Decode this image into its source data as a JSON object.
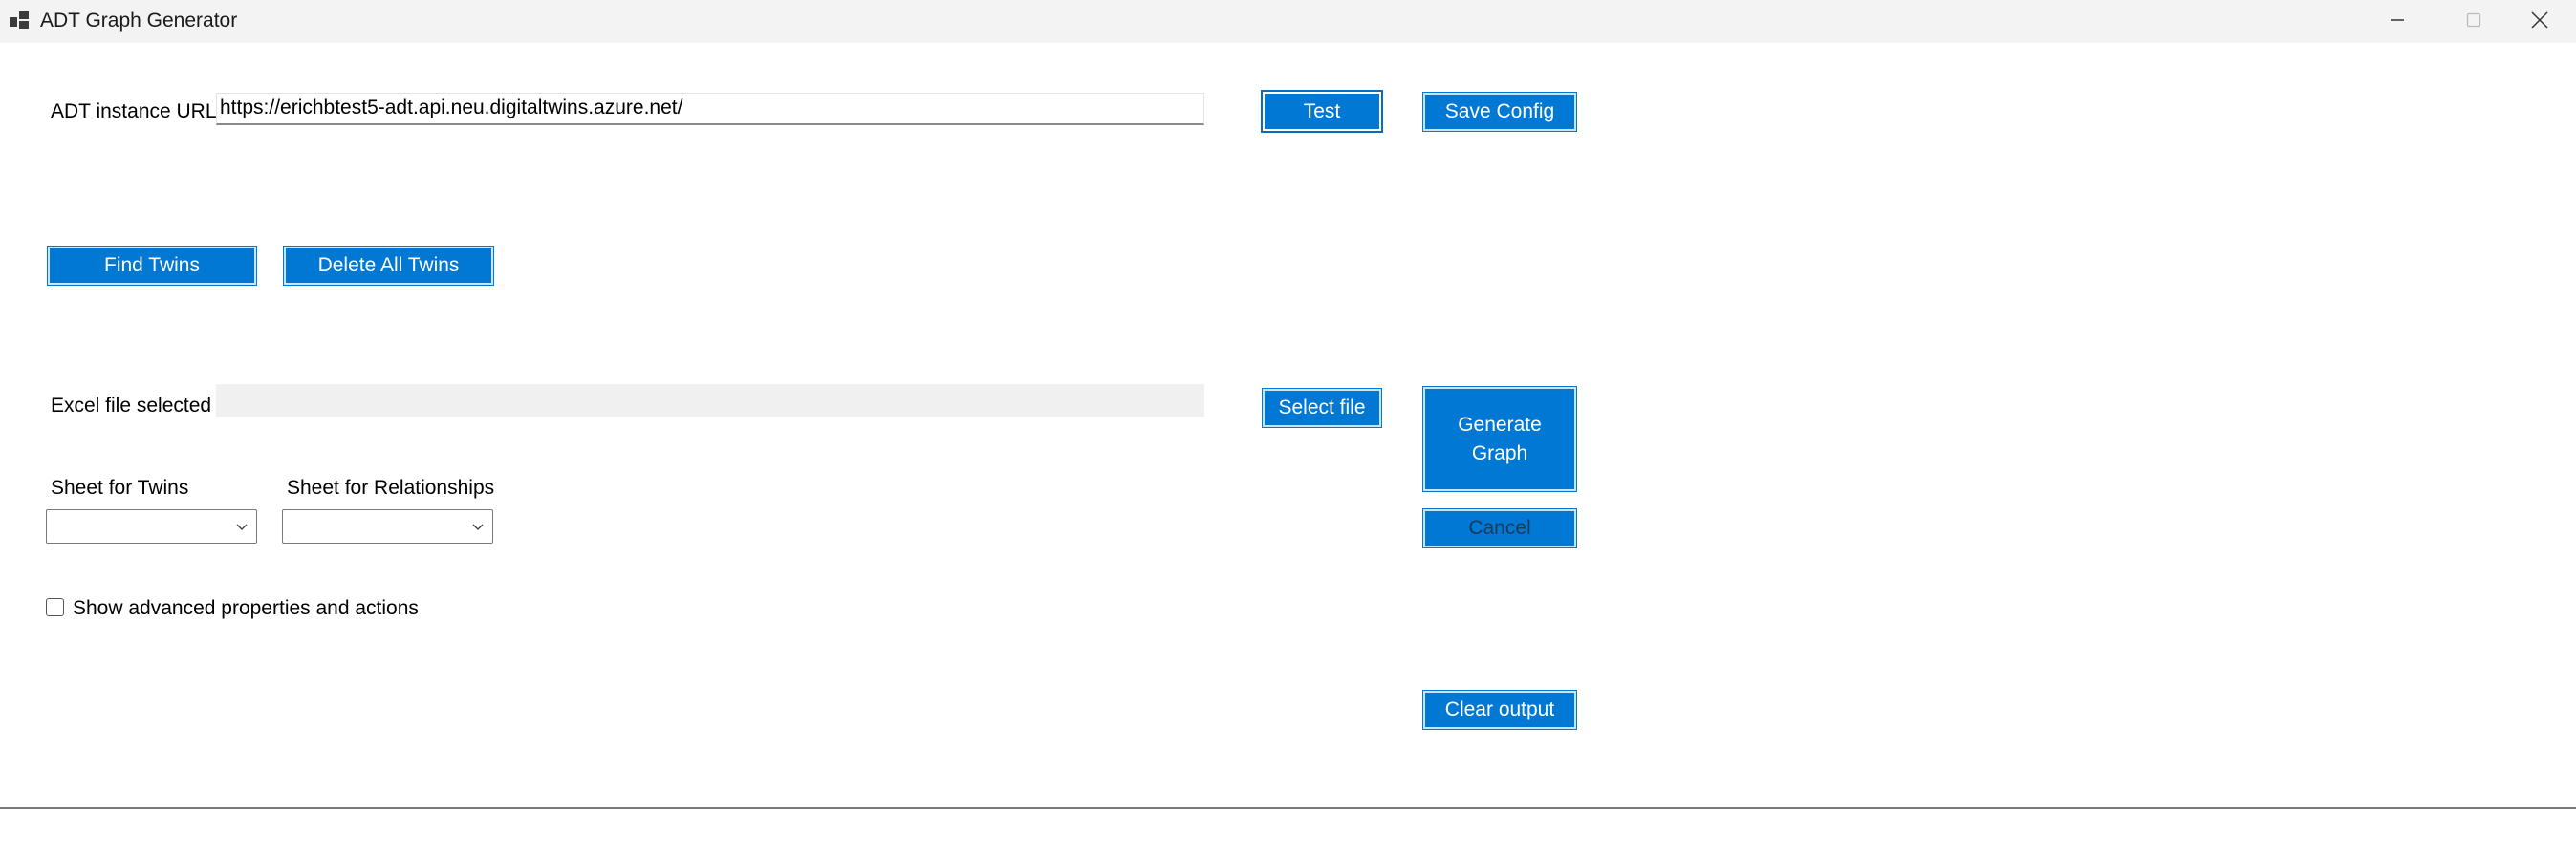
{
  "window": {
    "title": "ADT Graph Generator",
    "controls": {
      "minimize_icon": "minimize-icon",
      "maximize_icon": "maximize-icon",
      "close_icon": "close-icon"
    }
  },
  "config": {
    "url_label": "ADT instance URL",
    "url_value": "https://erichbtest5-adt.api.neu.digitaltwins.azure.net/",
    "test_label": "Test",
    "save_config_label": "Save Config"
  },
  "twins": {
    "find_label": "Find Twins",
    "delete_all_label": "Delete All Twins"
  },
  "excel": {
    "file_label": "Excel file selected",
    "file_value": "",
    "select_file_label": "Select file"
  },
  "sheets": {
    "twins_label": "Sheet for Twins",
    "twins_value": "",
    "relationships_label": "Sheet for Relationships",
    "relationships_value": ""
  },
  "graph": {
    "generate_line1": "Generate",
    "generate_line2": "Graph",
    "cancel_label": "Cancel"
  },
  "advanced": {
    "checkbox_label": "Show advanced properties and actions",
    "checked": false
  },
  "output": {
    "clear_label": "Clear output"
  },
  "colors": {
    "accent": "#0078d4",
    "titlebar": "#f3f3f3",
    "disabled_field": "#f0f0f0"
  }
}
